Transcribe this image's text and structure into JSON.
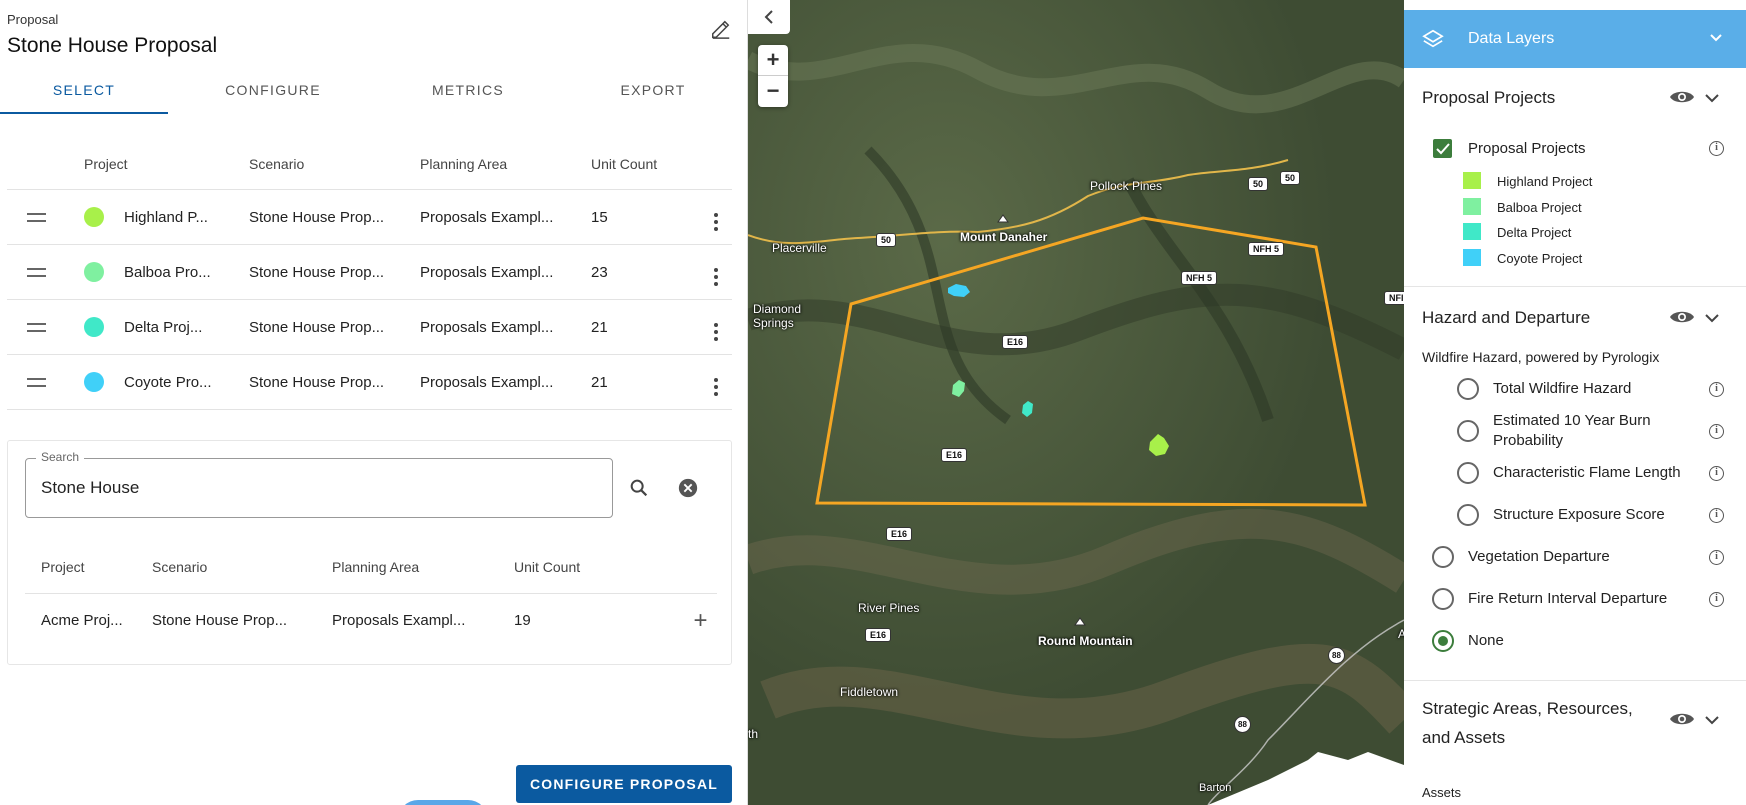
{
  "header": {
    "breadcrumb": "Proposal",
    "title": "Stone House Proposal"
  },
  "tabs": [
    "SELECT",
    "CONFIGURE",
    "METRICS",
    "EXPORT"
  ],
  "project_table": {
    "columns": [
      "Project",
      "Scenario",
      "Planning Area",
      "Unit Count"
    ],
    "rows": [
      {
        "project": "Highland P...",
        "scenario": "Stone House Prop...",
        "area": "Proposals Exampl...",
        "units": "15",
        "color": "#a8f04a"
      },
      {
        "project": "Balboa Pro...",
        "scenario": "Stone House Prop...",
        "area": "Proposals Exampl...",
        "units": "23",
        "color": "#7ff0a0"
      },
      {
        "project": "Delta Proj...",
        "scenario": "Stone House Prop...",
        "area": "Proposals Exampl...",
        "units": "21",
        "color": "#40e8c8"
      },
      {
        "project": "Coyote Pro...",
        "scenario": "Stone House Prop...",
        "area": "Proposals Exampl...",
        "units": "21",
        "color": "#40d0f8"
      }
    ]
  },
  "search": {
    "label": "Search",
    "value": "Stone House",
    "columns": [
      "Project",
      "Scenario",
      "Planning Area",
      "Unit Count"
    ],
    "results": [
      {
        "project": "Acme Proj...",
        "scenario": "Stone House Prop...",
        "area": "Proposals Exampl...",
        "units": "19"
      }
    ]
  },
  "configure_button": "CONFIGURE PROPOSAL",
  "map": {
    "labels": {
      "pollock_pines": "Pollock Pines",
      "mount_danaher": "Mount Danaher",
      "placerville": "Placerville",
      "diamond_springs": "Diamond\nSprings",
      "river_pines": "River Pines",
      "round_mountain": "Round Mountain",
      "fiddletown": "Fiddletown",
      "barton": "Barton",
      "th": "th",
      "a": "A"
    },
    "shields": {
      "us50_a": "50",
      "us50_b": "50",
      "us50_c": "50",
      "nfh5_a": "NFH 5",
      "nfh5_b": "NFH 5",
      "nfh_edge": "NFI",
      "e16_a": "E16",
      "e16_b": "E16",
      "e16_c": "E16",
      "e16_d": "E16",
      "r88_a": "88",
      "r88_b": "88"
    },
    "boundary_color": "#f5a623"
  },
  "layers": {
    "header": "Data Layers",
    "proposal_projects": {
      "title": "Proposal Projects",
      "checkbox_label": "Proposal Projects",
      "legend": [
        {
          "label": "Highland Project",
          "color": "#a8f04a"
        },
        {
          "label": "Balboa Project",
          "color": "#7ff0a0"
        },
        {
          "label": "Delta Project",
          "color": "#40e8c8"
        },
        {
          "label": "Coyote Project",
          "color": "#40d0f8"
        }
      ]
    },
    "hazard": {
      "title": "Hazard and Departure",
      "subtitle": "Wildfire Hazard, powered by Pyrologix",
      "nested_options": [
        "Total Wildfire Hazard",
        "Estimated 10 Year Burn Probability",
        "Characteristic Flame Length",
        "Structure Exposure Score"
      ],
      "options": [
        "Vegetation Departure",
        "Fire Return Interval Departure",
        "None"
      ],
      "selected": "None"
    },
    "strategic": {
      "title": "Strategic Areas, Resources, and Assets",
      "sub": "Assets"
    }
  }
}
